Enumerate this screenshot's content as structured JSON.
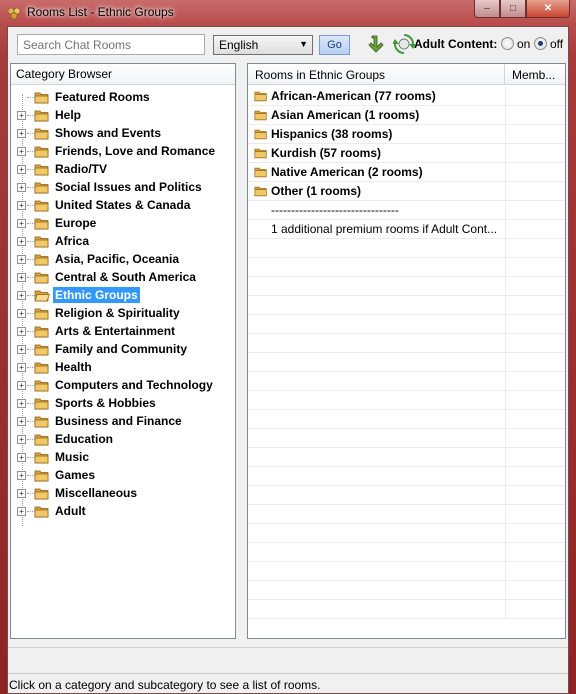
{
  "window": {
    "title": "Rooms List - Ethnic Groups"
  },
  "toolbar": {
    "search_placeholder": "Search Chat Rooms",
    "language": "English",
    "go_label": "Go",
    "adult_label": "Adult Content:",
    "radio_on_label": "on",
    "radio_off_label": "off",
    "adult_selected": "off"
  },
  "category_browser": {
    "header": "Category Browser",
    "items": [
      {
        "label": "Featured Rooms"
      },
      {
        "label": "Help"
      },
      {
        "label": "Shows and Events"
      },
      {
        "label": "Friends, Love and Romance"
      },
      {
        "label": "Radio/TV"
      },
      {
        "label": "Social Issues and Politics"
      },
      {
        "label": "United States & Canada"
      },
      {
        "label": "Europe"
      },
      {
        "label": "Africa"
      },
      {
        "label": "Asia, Pacific, Oceania"
      },
      {
        "label": "Central & South America"
      },
      {
        "label": "Ethnic Groups"
      },
      {
        "label": "Religion & Spirituality"
      },
      {
        "label": "Arts & Entertainment"
      },
      {
        "label": "Family and Community"
      },
      {
        "label": "Health"
      },
      {
        "label": "Computers and Technology"
      },
      {
        "label": "Sports & Hobbies"
      },
      {
        "label": "Business and Finance"
      },
      {
        "label": "Education"
      },
      {
        "label": "Music"
      },
      {
        "label": "Games"
      },
      {
        "label": "Miscellaneous"
      },
      {
        "label": "Adult"
      }
    ],
    "selected": "Ethnic Groups"
  },
  "rooms": {
    "header_name": "Rooms in Ethnic Groups",
    "header_members": "Memb...",
    "items": [
      {
        "label": "African-American (77 rooms)"
      },
      {
        "label": "Asian American (1 rooms)"
      },
      {
        "label": "Hispanics (38 rooms)"
      },
      {
        "label": "Kurdish (57 rooms)"
      },
      {
        "label": "Native American (2 rooms)"
      },
      {
        "label": "Other (1 rooms)"
      }
    ],
    "separator": "--------------------------------",
    "note": "1 additional premium rooms if Adult Cont..."
  },
  "status": {
    "text": "Click on a category and subcategory to see a list of rooms."
  },
  "colors": {
    "selection": "#3399ff",
    "folder": "#e8b34a"
  }
}
